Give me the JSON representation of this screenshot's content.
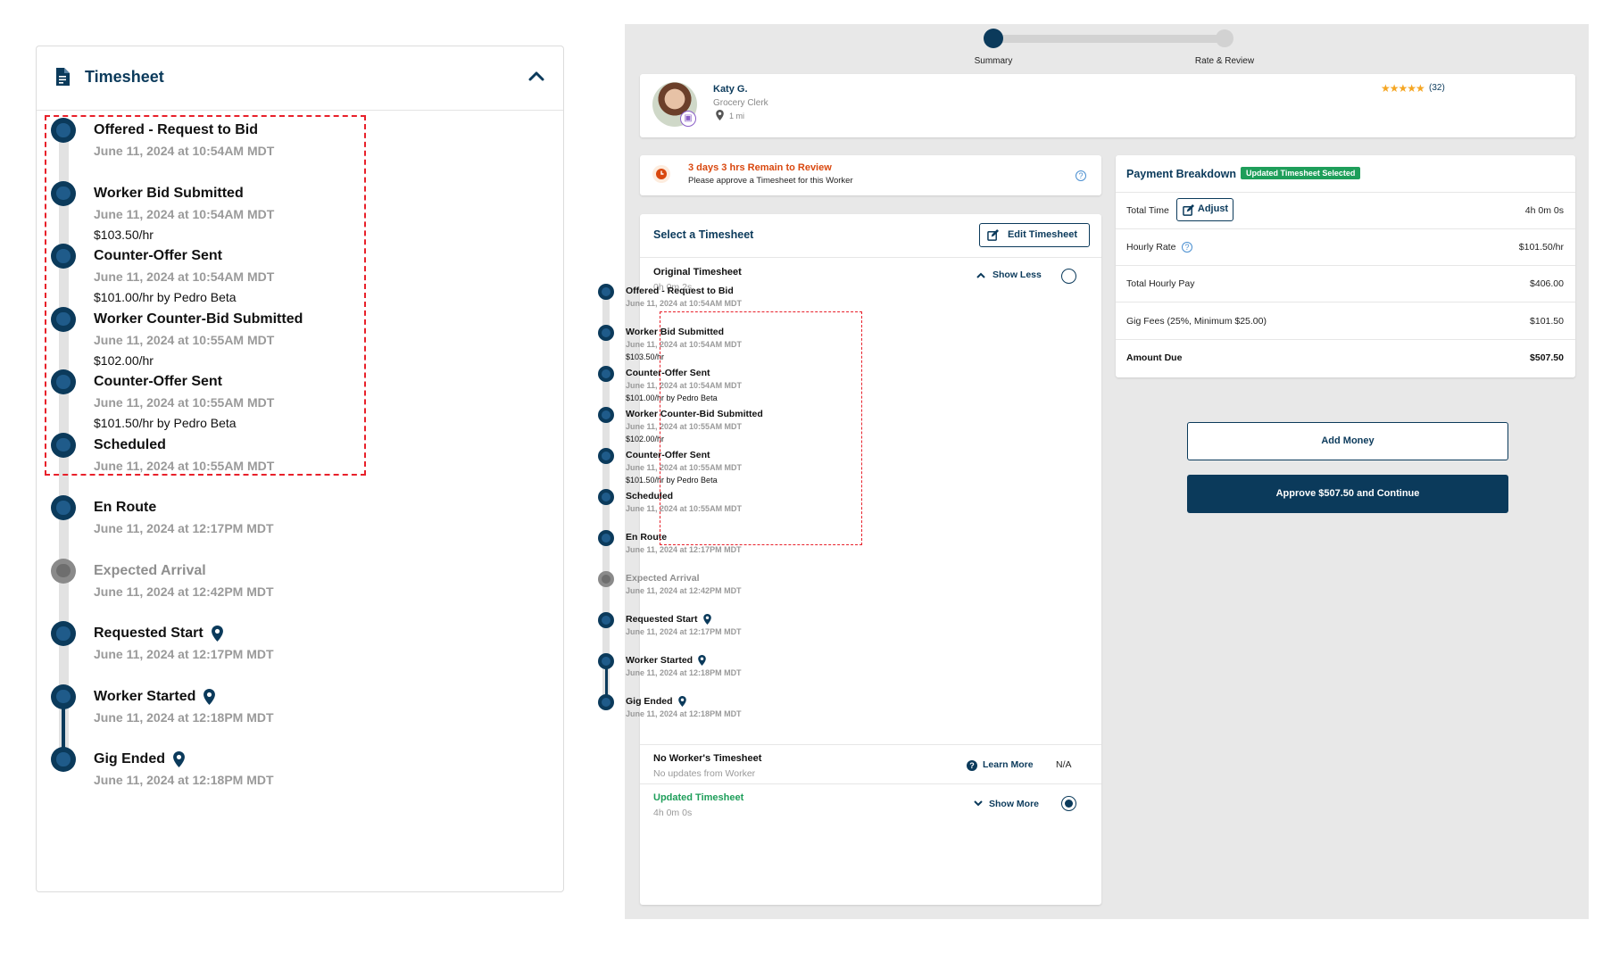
{
  "left_panel": {
    "title": "Timesheet",
    "events": [
      {
        "title": "Offered - Request to Bid",
        "date": "June 11, 2024 at 10:54AM MDT",
        "extra": "",
        "pin": false,
        "grey": false
      },
      {
        "title": "Worker Bid Submitted",
        "date": "June 11, 2024 at 10:54AM MDT",
        "extra": "$103.50/hr",
        "pin": false,
        "grey": false
      },
      {
        "title": "Counter-Offer Sent",
        "date": "June 11, 2024 at 10:54AM MDT",
        "extra": "$101.00/hr by Pedro Beta",
        "pin": false,
        "grey": false
      },
      {
        "title": "Worker Counter-Bid Submitted",
        "date": "June 11, 2024 at 10:55AM MDT",
        "extra": "$102.00/hr",
        "pin": false,
        "grey": false
      },
      {
        "title": "Counter-Offer Sent",
        "date": "June 11, 2024 at 10:55AM MDT",
        "extra": "$101.50/hr by Pedro Beta",
        "pin": false,
        "grey": false
      },
      {
        "title": "Scheduled",
        "date": "June 11, 2024 at 10:55AM MDT",
        "extra": "",
        "pin": false,
        "grey": false
      },
      {
        "title": "En Route",
        "date": "June 11, 2024 at 12:17PM MDT",
        "extra": "",
        "pin": false,
        "grey": false
      },
      {
        "title": "Expected Arrival",
        "date": "June 11, 2024 at 12:42PM MDT",
        "extra": "",
        "pin": false,
        "grey": true
      },
      {
        "title": "Requested Start",
        "date": "June 11, 2024 at 12:17PM MDT",
        "extra": "",
        "pin": true,
        "grey": false
      },
      {
        "title": "Worker Started",
        "date": "June 11, 2024 at 12:18PM MDT",
        "extra": "",
        "pin": true,
        "grey": false
      },
      {
        "title": "Gig Ended",
        "date": "June 11, 2024 at 12:18PM MDT",
        "extra": "",
        "pin": true,
        "grey": false
      }
    ]
  },
  "stepper": {
    "steps": [
      "Summary",
      "Rate & Review"
    ],
    "active_step": 1
  },
  "worker": {
    "name": "Katy G.",
    "role": "Grocery Clerk",
    "distance": "1 mi",
    "rating_count": "(32)",
    "stars": 4.5
  },
  "review_notice": {
    "headline": "3 days 3 hrs Remain to Review",
    "subtext": "Please approve a Timesheet for this Worker"
  },
  "select_timesheet": {
    "title": "Select a Timesheet",
    "edit_label": "Edit Timesheet",
    "original": {
      "label": "Original Timesheet",
      "duration": "0h 0m 2s",
      "toggle": "Show Less"
    },
    "no_worker": {
      "label": "No Worker's Timesheet",
      "sub": "No updates from Worker",
      "learn_more": "Learn More",
      "value": "N/A"
    },
    "updated": {
      "label": "Updated Timesheet",
      "duration": "4h 0m 0s",
      "toggle": "Show More"
    }
  },
  "payment": {
    "title": "Payment Breakdown",
    "badge": "Updated Timesheet Selected",
    "adjust_label": "Adjust",
    "rows": [
      {
        "label": "Total Time",
        "value": "4h 0m 0s"
      },
      {
        "label": "Hourly Rate",
        "value": "$101.50/hr"
      },
      {
        "label": "Total Hourly Pay",
        "value": "$406.00"
      },
      {
        "label": "Gig Fees (25%, Minimum $25.00)",
        "value": "$101.50"
      },
      {
        "label": "Amount Due",
        "value": "$507.50"
      }
    ],
    "add_money": "Add Money",
    "approve": "Approve $507.50 and Continue"
  },
  "colors": {
    "navy": "#0b3a5b",
    "accent_red": "#d9480f",
    "green": "#1e9e5a",
    "star": "#f5a623",
    "dash": "#e8202a"
  }
}
